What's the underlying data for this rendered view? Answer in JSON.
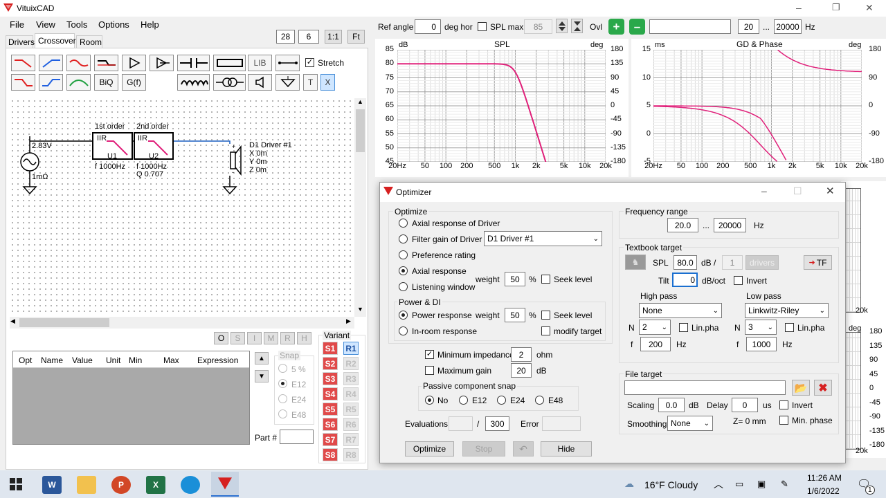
{
  "app": {
    "title": "VituixCAD",
    "minimize": "–",
    "maximize": "❐",
    "close": "✕"
  },
  "menu": [
    "File",
    "View",
    "Tools",
    "Options",
    "Help"
  ],
  "tabs": [
    "Drivers",
    "Crossover",
    "Room"
  ],
  "zoom": {
    "a": "28",
    "b": "6",
    "c": "1:1",
    "d": "Ft"
  },
  "toolbar": {
    "lib": "LIB",
    "stretch": "Stretch",
    "biq": "BiQ",
    "gf": "G(f)",
    "t": "T",
    "x": "X"
  },
  "schematic": {
    "source_v": "2.83V",
    "source_r": "1mΩ",
    "u1_title": "1st order",
    "u1_type": "IIR",
    "u1_name": "U1",
    "u1_f": "f  1000Hz",
    "u2_title": "2nd order",
    "u2_type": "IIR",
    "u2_name": "U2",
    "u2_f": "f  1000Hz",
    "u2_q": "Q  0.707",
    "driver_name": "D1 Driver #1",
    "driver_x": "X 0m",
    "driver_y": "Y 0m",
    "driver_z": "Z 0m"
  },
  "opt_buttons": [
    "O",
    "S",
    "I",
    "M",
    "R",
    "H"
  ],
  "table_headers": [
    "Opt",
    "Name",
    "Value",
    "Unit",
    "Min",
    "Max",
    "Expression"
  ],
  "snap": {
    "title": "Snap",
    "items": [
      "5 %",
      "E12",
      "E24",
      "E48"
    ]
  },
  "part_label": "Part #",
  "variant": {
    "title": "Variant",
    "s": [
      "S1",
      "S2",
      "S3",
      "S4",
      "S5",
      "S6",
      "S7",
      "S8"
    ],
    "r": [
      "R1",
      "R2",
      "R3",
      "R4",
      "R5",
      "R6",
      "R7",
      "R8"
    ]
  },
  "topbar": {
    "ref_angle_label": "Ref angle",
    "ref_angle": "0",
    "deg_hor": "deg hor",
    "spl_max_label": "SPL max",
    "spl_max": "85",
    "ovl": "Ovl",
    "f_lo": "20",
    "dots": "...",
    "f_hi": "20000",
    "hz": "Hz"
  },
  "spl_chart": {
    "title": "SPL",
    "left_unit": "dB",
    "right_unit": "deg",
    "y_left": [
      "85",
      "80",
      "75",
      "70",
      "65",
      "60",
      "55",
      "50",
      "45"
    ],
    "y_right": [
      "180",
      "135",
      "90",
      "45",
      "0",
      "-45",
      "-90",
      "-135",
      "-180"
    ],
    "x": [
      "20Hz",
      "50",
      "100",
      "200",
      "500",
      "1k",
      "2k",
      "5k",
      "10k",
      "20k"
    ]
  },
  "gd_chart": {
    "title": "GD & Phase",
    "left_unit": "ms",
    "right_unit": "deg",
    "y_left": [
      "15",
      "10",
      "5",
      "0",
      "-5"
    ],
    "y_right": [
      "180",
      "90",
      "0",
      "-90",
      "-180"
    ],
    "x": [
      "20Hz",
      "50",
      "100",
      "200",
      "500",
      "1k",
      "2k",
      "5k",
      "10k",
      "20k"
    ]
  },
  "bg_chart": {
    "right_unit": "deg",
    "y_right": [
      "180",
      "135",
      "90",
      "45",
      "0",
      "-45",
      "-90",
      "-135",
      "-180"
    ],
    "x_end": "20k"
  },
  "optimizer": {
    "title": "Optimizer",
    "optimize_label": "Optimize",
    "opt1": "Axial response of Driver",
    "opt2": "Filter gain of Driver",
    "driver_select": "D1 Driver #1",
    "opt3": "Preference rating",
    "opt4": "Axial response",
    "opt5": "Listening window",
    "weight_label": "weight",
    "weight1": "50",
    "pct": "%",
    "seek_level": "Seek level",
    "power_di": "Power & DI",
    "power_response": "Power response",
    "weight2": "50",
    "inroom": "In-room response",
    "modify_target": "modify target",
    "min_imp": "Minimum impedance",
    "min_imp_val": "2",
    "ohm": "ohm",
    "max_gain": "Maximum gain",
    "max_gain_val": "20",
    "db": "dB",
    "passive_snap": "Passive component snap",
    "snap_opts": [
      "No",
      "E12",
      "E24",
      "E48"
    ],
    "evaluations": "Evaluations",
    "slash": "/",
    "eval_max": "300",
    "error": "Error",
    "btn_optimize": "Optimize",
    "btn_stop": "Stop",
    "btn_hide": "Hide",
    "freq_range": "Frequency range",
    "f_lo": "20.0",
    "f_hi": "20000",
    "hz": "Hz",
    "textbook_target": "Textbook target",
    "spl_label": "SPL",
    "spl_val": "80.0",
    "db_slash": "dB /",
    "drivers_count": "1",
    "drivers_btn": "drivers",
    "tf_btn": "TF",
    "tilt_label": "Tilt",
    "tilt_val": "0",
    "dboct": "dB/oct",
    "invert": "Invert",
    "high_pass": "High pass",
    "low_pass": "Low pass",
    "hp_type": "None",
    "lp_type": "Linkwitz-Riley",
    "n_label": "N",
    "hp_n": "2",
    "lp_n": "3",
    "linpha": "Lin.pha",
    "f_label": "f",
    "hp_f": "200",
    "lp_f": "1000",
    "file_target": "File target",
    "scaling": "Scaling",
    "scaling_val": "0.0",
    "delay": "Delay",
    "delay_val": "0",
    "us": "us",
    "smoothing": "Smoothing",
    "smoothing_val": "None",
    "z0": "Z= 0 mm",
    "min_phase": "Min. phase"
  },
  "taskbar": {
    "weather": "16°F  Cloudy",
    "time": "11:26 AM",
    "date": "1/6/2022",
    "notif": "1"
  }
}
